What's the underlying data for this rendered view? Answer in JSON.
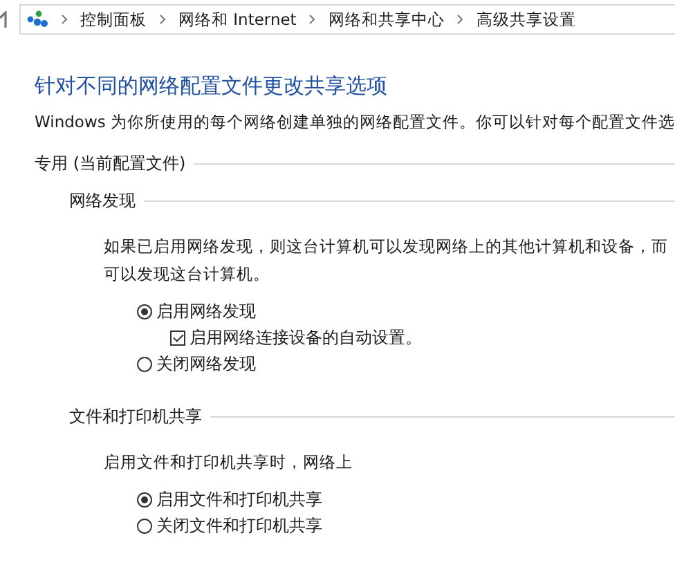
{
  "breadcrumb": {
    "items": [
      "控制面板",
      "网络和 Internet",
      "网络和共享中心",
      "高级共享设置"
    ]
  },
  "heading": "针对不同的网络配置文件更改共享选项",
  "description": "Windows 为你所使用的每个网络创建单独的网络配置文件。你可以针对每个配置文件选",
  "sections": [
    {
      "title": "专用 (当前配置文件)",
      "groups": [
        {
          "title": "网络发现",
          "lines": [
            "如果已启用网络发现，则这台计算机可以发现网络上的其他计算机和设备，而",
            "可以发现这台计算机。"
          ],
          "options": [
            {
              "kind": "radio",
              "label": "启用网络发现",
              "selected": true,
              "children": [
                {
                  "kind": "checkbox",
                  "label": "启用网络连接设备的自动设置。",
                  "checked": true
                }
              ]
            },
            {
              "kind": "radio",
              "label": "关闭网络发现",
              "selected": false
            }
          ]
        },
        {
          "title": "文件和打印机共享",
          "lines": [
            "启用文件和打印机共享时，网络上"
          ],
          "options": [
            {
              "kind": "radio",
              "label": "启用文件和打印机共享",
              "selected": true
            },
            {
              "kind": "radio",
              "label": "关闭文件和打印机共享",
              "selected": false
            }
          ]
        }
      ]
    }
  ]
}
